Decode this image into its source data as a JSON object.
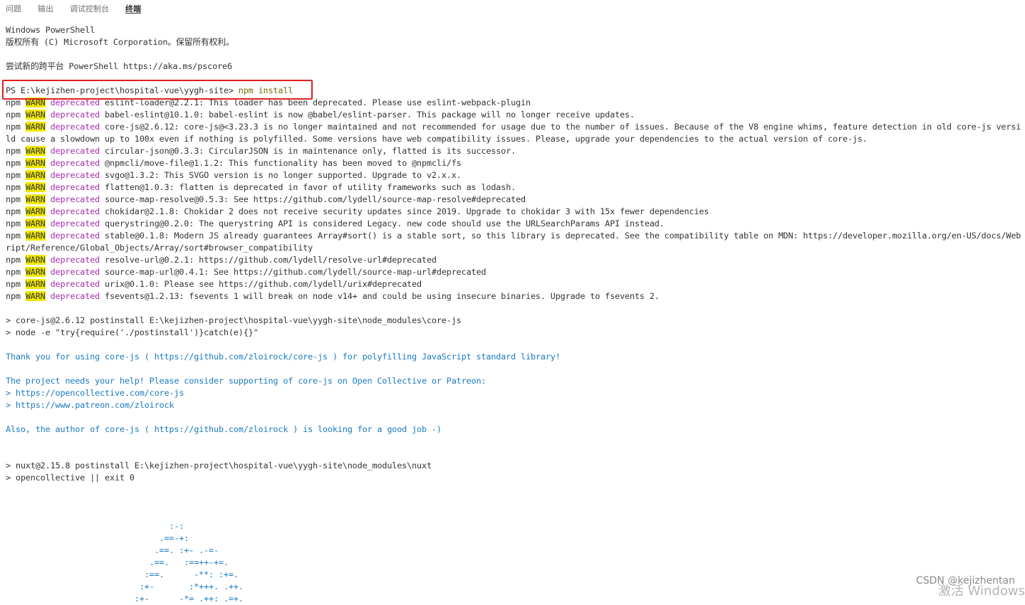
{
  "tabs": [
    "问题",
    "输出",
    "调试控制台",
    "终端"
  ],
  "active_tab": "终端",
  "terminal": {
    "header": [
      "Windows PowerShell",
      "版权所有 (C) Microsoft Corporation。保留所有权利。",
      "",
      "尝试新的跨平台 PowerShell https://aka.ms/pscore6",
      ""
    ],
    "prompt": "PS E:\\kejizhen-project\\hospital-vue\\yygh-site>",
    "command": "npm install",
    "npm_label": "npm",
    "warn_label": "WARN",
    "deprecated_label": "deprecated",
    "warnings": [
      {
        "msg": "eslint-loader@2.2.1: This loader has been deprecated. Please use eslint-webpack-plugin"
      },
      {
        "msg": "babel-eslint@10.1.0: babel-eslint is now @babel/eslint-parser. This package will no longer receive updates."
      },
      {
        "msg": "core-js@2.6.12: core-js@<3.23.3 is no longer maintained and not recommended for usage due to the number of issues. Because of the V8 engine whims, feature detection in old core-js versi",
        "cont": "ld cause a slowdown up to 100x even if nothing is polyfilled. Some versions have web compatibility issues. Please, upgrade your dependencies to the actual version of core-js."
      },
      {
        "msg": "circular-json@0.3.3: CircularJSON is in maintenance only, flatted is its successor."
      },
      {
        "msg": "@npmcli/move-file@1.1.2: This functionality has been moved to @npmcli/fs"
      },
      {
        "msg": "svgo@1.3.2: This SVGO version is no longer supported. Upgrade to v2.x.x."
      },
      {
        "msg": "flatten@1.0.3: flatten is deprecated in favor of utility frameworks such as lodash."
      },
      {
        "msg": "source-map-resolve@0.5.3: See https://github.com/lydell/source-map-resolve#deprecated"
      },
      {
        "msg": "chokidar@2.1.8: Chokidar 2 does not receive security updates since 2019. Upgrade to chokidar 3 with 15x fewer dependencies"
      },
      {
        "msg": "querystring@0.2.0: The querystring API is considered Legacy. new code should use the URLSearchParams API instead."
      },
      {
        "msg": "stable@0.1.8: Modern JS already guarantees Array#sort() is a stable sort, so this library is deprecated. See the compatibility table on MDN: https://developer.mozilla.org/en-US/docs/Web",
        "cont": "ript/Reference/Global_Objects/Array/sort#browser_compatibility"
      },
      {
        "msg": "resolve-url@0.2.1: https://github.com/lydell/resolve-url#deprecated"
      },
      {
        "msg": "source-map-url@0.4.1: See https://github.com/lydell/source-map-url#deprecated"
      },
      {
        "msg": "urix@0.1.0: Please see https://github.com/lydell/urix#deprecated"
      },
      {
        "msg": "fsevents@1.2.13: fsevents 1 will break on node v14+ and could be using insecure binaries. Upgrade to fsevents 2."
      }
    ],
    "postinstall": [
      {
        "text": "",
        "style": "plain"
      },
      {
        "text": "> core-js@2.6.12 postinstall E:\\kejizhen-project\\hospital-vue\\yygh-site\\node_modules\\core-js",
        "style": "plain"
      },
      {
        "text": "> node -e \"try{require('./postinstall')}catch(e){}\"",
        "style": "plain"
      },
      {
        "text": "",
        "style": "plain"
      },
      {
        "text": "Thank you for using core-js ( https://github.com/zloirock/core-js ) for polyfilling JavaScript standard library!",
        "style": "cyan"
      },
      {
        "text": "",
        "style": "plain"
      },
      {
        "text": "The project needs your help! Please consider supporting of core-js on Open Collective or Patreon:",
        "style": "cyan"
      },
      {
        "text": "> https://opencollective.com/core-js",
        "style": "cyan"
      },
      {
        "text": "> https://www.patreon.com/zloirock",
        "style": "cyan"
      },
      {
        "text": "",
        "style": "plain"
      },
      {
        "text": "Also, the author of core-js ( https://github.com/zloirock ) is looking for a good job -)",
        "style": "cyan"
      },
      {
        "text": "",
        "style": "plain"
      },
      {
        "text": "",
        "style": "plain"
      },
      {
        "text": "> nuxt@2.15.8 postinstall E:\\kejizhen-project\\hospital-vue\\yygh-site\\node_modules\\nuxt",
        "style": "plain"
      },
      {
        "text": "> opencollective || exit 0",
        "style": "plain"
      },
      {
        "text": "",
        "style": "plain"
      },
      {
        "text": "",
        "style": "plain"
      },
      {
        "text": "",
        "style": "plain"
      },
      {
        "text": "                                 :-:",
        "style": "art"
      },
      {
        "text": "                               .==-+:",
        "style": "art"
      },
      {
        "text": "                              .==. :+- .-=-",
        "style": "art"
      },
      {
        "text": "                             .==.   :==++-+=.",
        "style": "art"
      },
      {
        "text": "                            :==.      -**: :+=.",
        "style": "art"
      },
      {
        "text": "                           :+-       :*+++. .++.",
        "style": "art"
      },
      {
        "text": "                          :+-      -*= .++: .=+.",
        "style": "art"
      }
    ]
  },
  "watermark": "CSDN @kejizhentan",
  "watermark2": "激活 Windows"
}
